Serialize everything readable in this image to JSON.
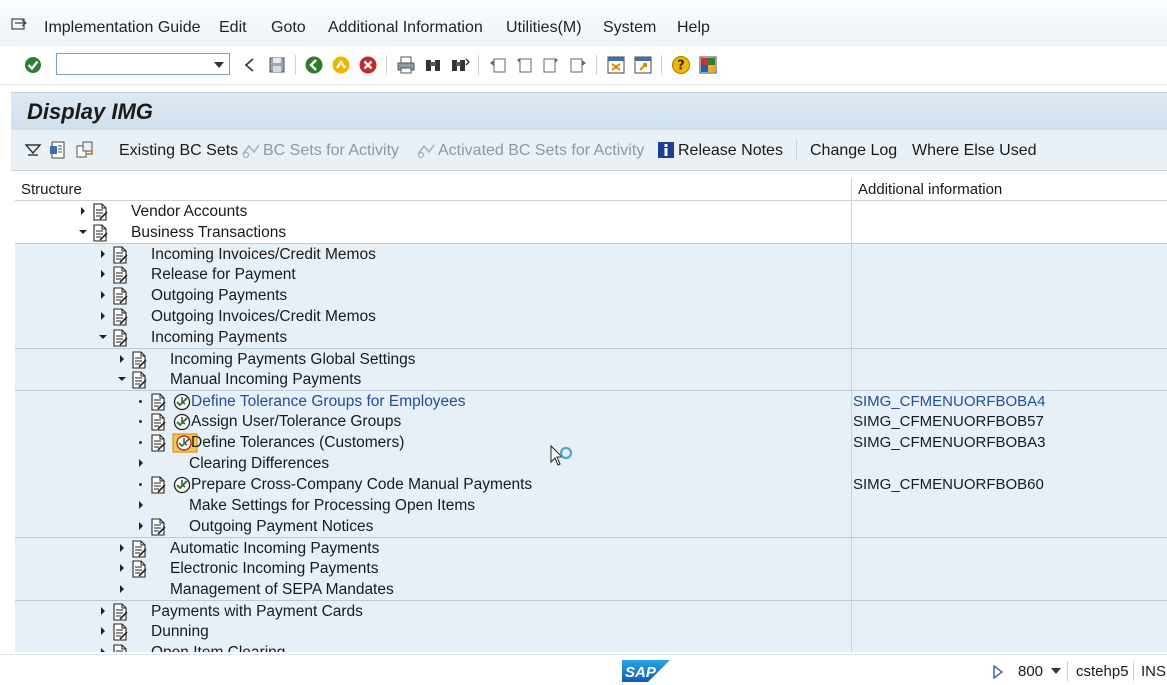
{
  "menu": {
    "items": [
      "Implementation Guide",
      "Edit",
      "Goto",
      "Additional Information",
      "Utilities(M)",
      "System",
      "Help"
    ]
  },
  "toolbar": {
    "command_value": "",
    "icons": [
      "enter-icon",
      "back-icon",
      "save-icon",
      "back-green-icon",
      "exit-icon",
      "cancel-icon",
      "print-icon",
      "find-icon",
      "find-next-icon",
      "first-page-icon",
      "previous-page-icon",
      "next-page-icon",
      "last-page-icon",
      "create-session-icon",
      "shortcut-icon",
      "help-icon",
      "layout-icon"
    ]
  },
  "title": "Display IMG",
  "app_toolbar": {
    "existing_bc_sets": "Existing BC Sets",
    "bc_sets_for_activity": "BC Sets for Activity",
    "activated_bc_sets": "Activated BC Sets for Activity",
    "release_notes": "Release Notes",
    "change_log": "Change Log",
    "where_else_used": "Where Else Used"
  },
  "tree": {
    "col_structure": "Structure",
    "col_additional": "Additional information",
    "rows": [
      {
        "label": "Vendor Accounts",
        "info": ""
      },
      {
        "label": "Business Transactions",
        "info": ""
      },
      {
        "label": "Incoming Invoices/Credit Memos",
        "info": ""
      },
      {
        "label": "Release for Payment",
        "info": ""
      },
      {
        "label": "Outgoing Payments",
        "info": ""
      },
      {
        "label": "Outgoing Invoices/Credit Memos",
        "info": ""
      },
      {
        "label": "Incoming Payments",
        "info": ""
      },
      {
        "label": "Incoming Payments Global Settings",
        "info": ""
      },
      {
        "label": "Manual Incoming Payments",
        "info": ""
      },
      {
        "label": "Define Tolerance Groups for Employees",
        "info": "SIMG_CFMENUORFBOBA4"
      },
      {
        "label": "Assign User/Tolerance Groups",
        "info": "SIMG_CFMENUORFBOB57"
      },
      {
        "label": "Define Tolerances (Customers)",
        "info": "SIMG_CFMENUORFBOBA3"
      },
      {
        "label": "Clearing Differences",
        "info": ""
      },
      {
        "label": "Prepare Cross-Company Code Manual Payments",
        "info": "SIMG_CFMENUORFBOB60"
      },
      {
        "label": "Make Settings for Processing Open Items",
        "info": ""
      },
      {
        "label": "Outgoing Payment Notices",
        "info": ""
      },
      {
        "label": "Automatic Incoming Payments",
        "info": ""
      },
      {
        "label": "Electronic Incoming Payments",
        "info": ""
      },
      {
        "label": "Management of SEPA Mandates",
        "info": ""
      },
      {
        "label": "Payments with Payment Cards",
        "info": ""
      },
      {
        "label": "Dunning",
        "info": ""
      },
      {
        "label": "Open Item Clearing",
        "info": ""
      }
    ]
  },
  "status": {
    "client": "800",
    "server": "cstehp5",
    "mode": "INS"
  }
}
